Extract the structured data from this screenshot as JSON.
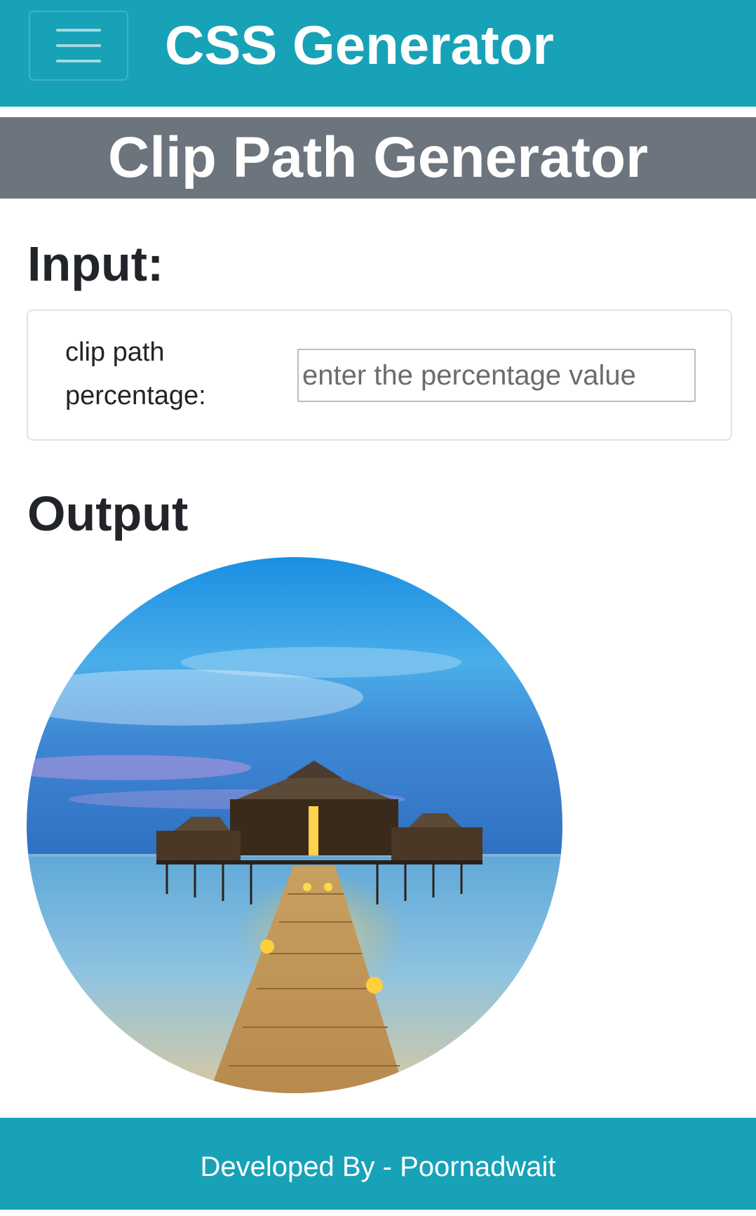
{
  "navbar": {
    "brand": "CSS Generator",
    "toggler_icon": "hamburger-menu-icon"
  },
  "page_header": {
    "title": "Clip Path Generator"
  },
  "input_section": {
    "heading": "Input:",
    "label": "clip path percentage:",
    "placeholder": "enter the percentage value",
    "value": ""
  },
  "output_section": {
    "heading": "Output",
    "image": {
      "description_icon": "overwater-villa-image",
      "shape": "circle"
    }
  },
  "footer": {
    "text": "Developed By - Poornadwait"
  },
  "colors": {
    "navbar_bg": "#17a2b8",
    "header_bg": "#6c757d",
    "footer_bg": "#17a2b8",
    "text": "#212529"
  }
}
